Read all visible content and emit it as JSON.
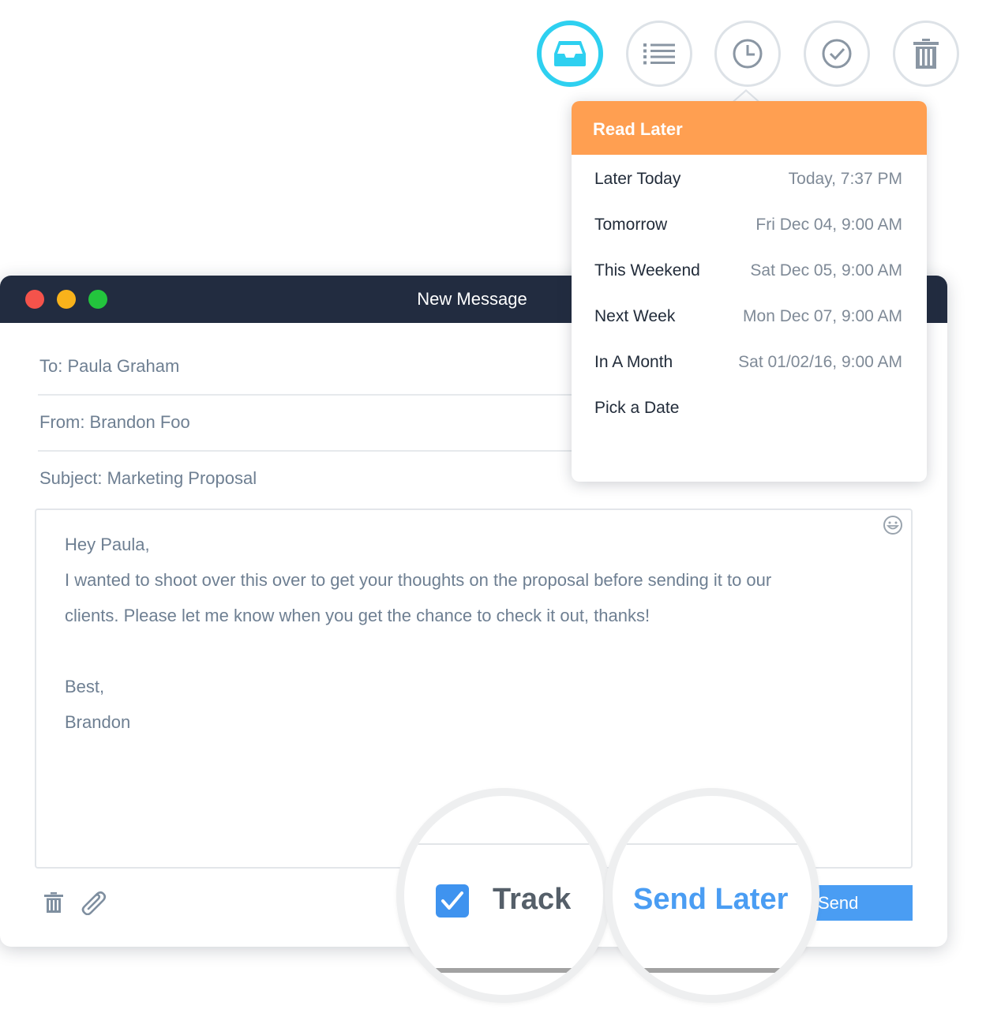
{
  "toolbar": {
    "buttons": [
      {
        "name": "inbox",
        "icon": "inbox-tray-icon",
        "active": true
      },
      {
        "name": "list",
        "icon": "list-icon",
        "active": false
      },
      {
        "name": "read-later",
        "icon": "clock-icon",
        "active": false
      },
      {
        "name": "done",
        "icon": "checkmark-icon",
        "active": false
      },
      {
        "name": "trash",
        "icon": "trash-icon",
        "active": false
      }
    ],
    "active_color": "#2ed0f0"
  },
  "window": {
    "title": "New Message",
    "controls": [
      "close",
      "minimize",
      "zoom"
    ]
  },
  "compose": {
    "to": "To: Paula Graham",
    "from": "From: Brandon Foo",
    "subject": "Subject: Marketing Proposal",
    "body": {
      "greeting": "Hey Paula,",
      "line1": "I wanted to shoot over this over to get your thoughts on the proposal before sending it to our",
      "line2": "clients. Please let me know when you get the chance to check it out, thanks!",
      "signoff": "Best,",
      "name": "Brandon"
    },
    "emoji_icon": "smiley-icon",
    "track_label": "Track",
    "track_checked": true,
    "send_later_label": "Send Later",
    "send_label": "Send",
    "accent_color": "#4a9df3"
  },
  "dropdown": {
    "title": "Read Later",
    "header_color": "#ff9f51",
    "items": [
      {
        "label": "Later Today",
        "time": "Today, 7:37 PM"
      },
      {
        "label": "Tomorrow",
        "time": "Fri Dec 04, 9:00 AM"
      },
      {
        "label": "This Weekend",
        "time": "Sat Dec 05, 9:00 AM"
      },
      {
        "label": "Next Week",
        "time": "Mon Dec 07, 9:00 AM"
      },
      {
        "label": "In A Month",
        "time": "Sat 01/02/16, 9:00 AM"
      },
      {
        "label": "Pick a Date",
        "time": ""
      }
    ]
  }
}
